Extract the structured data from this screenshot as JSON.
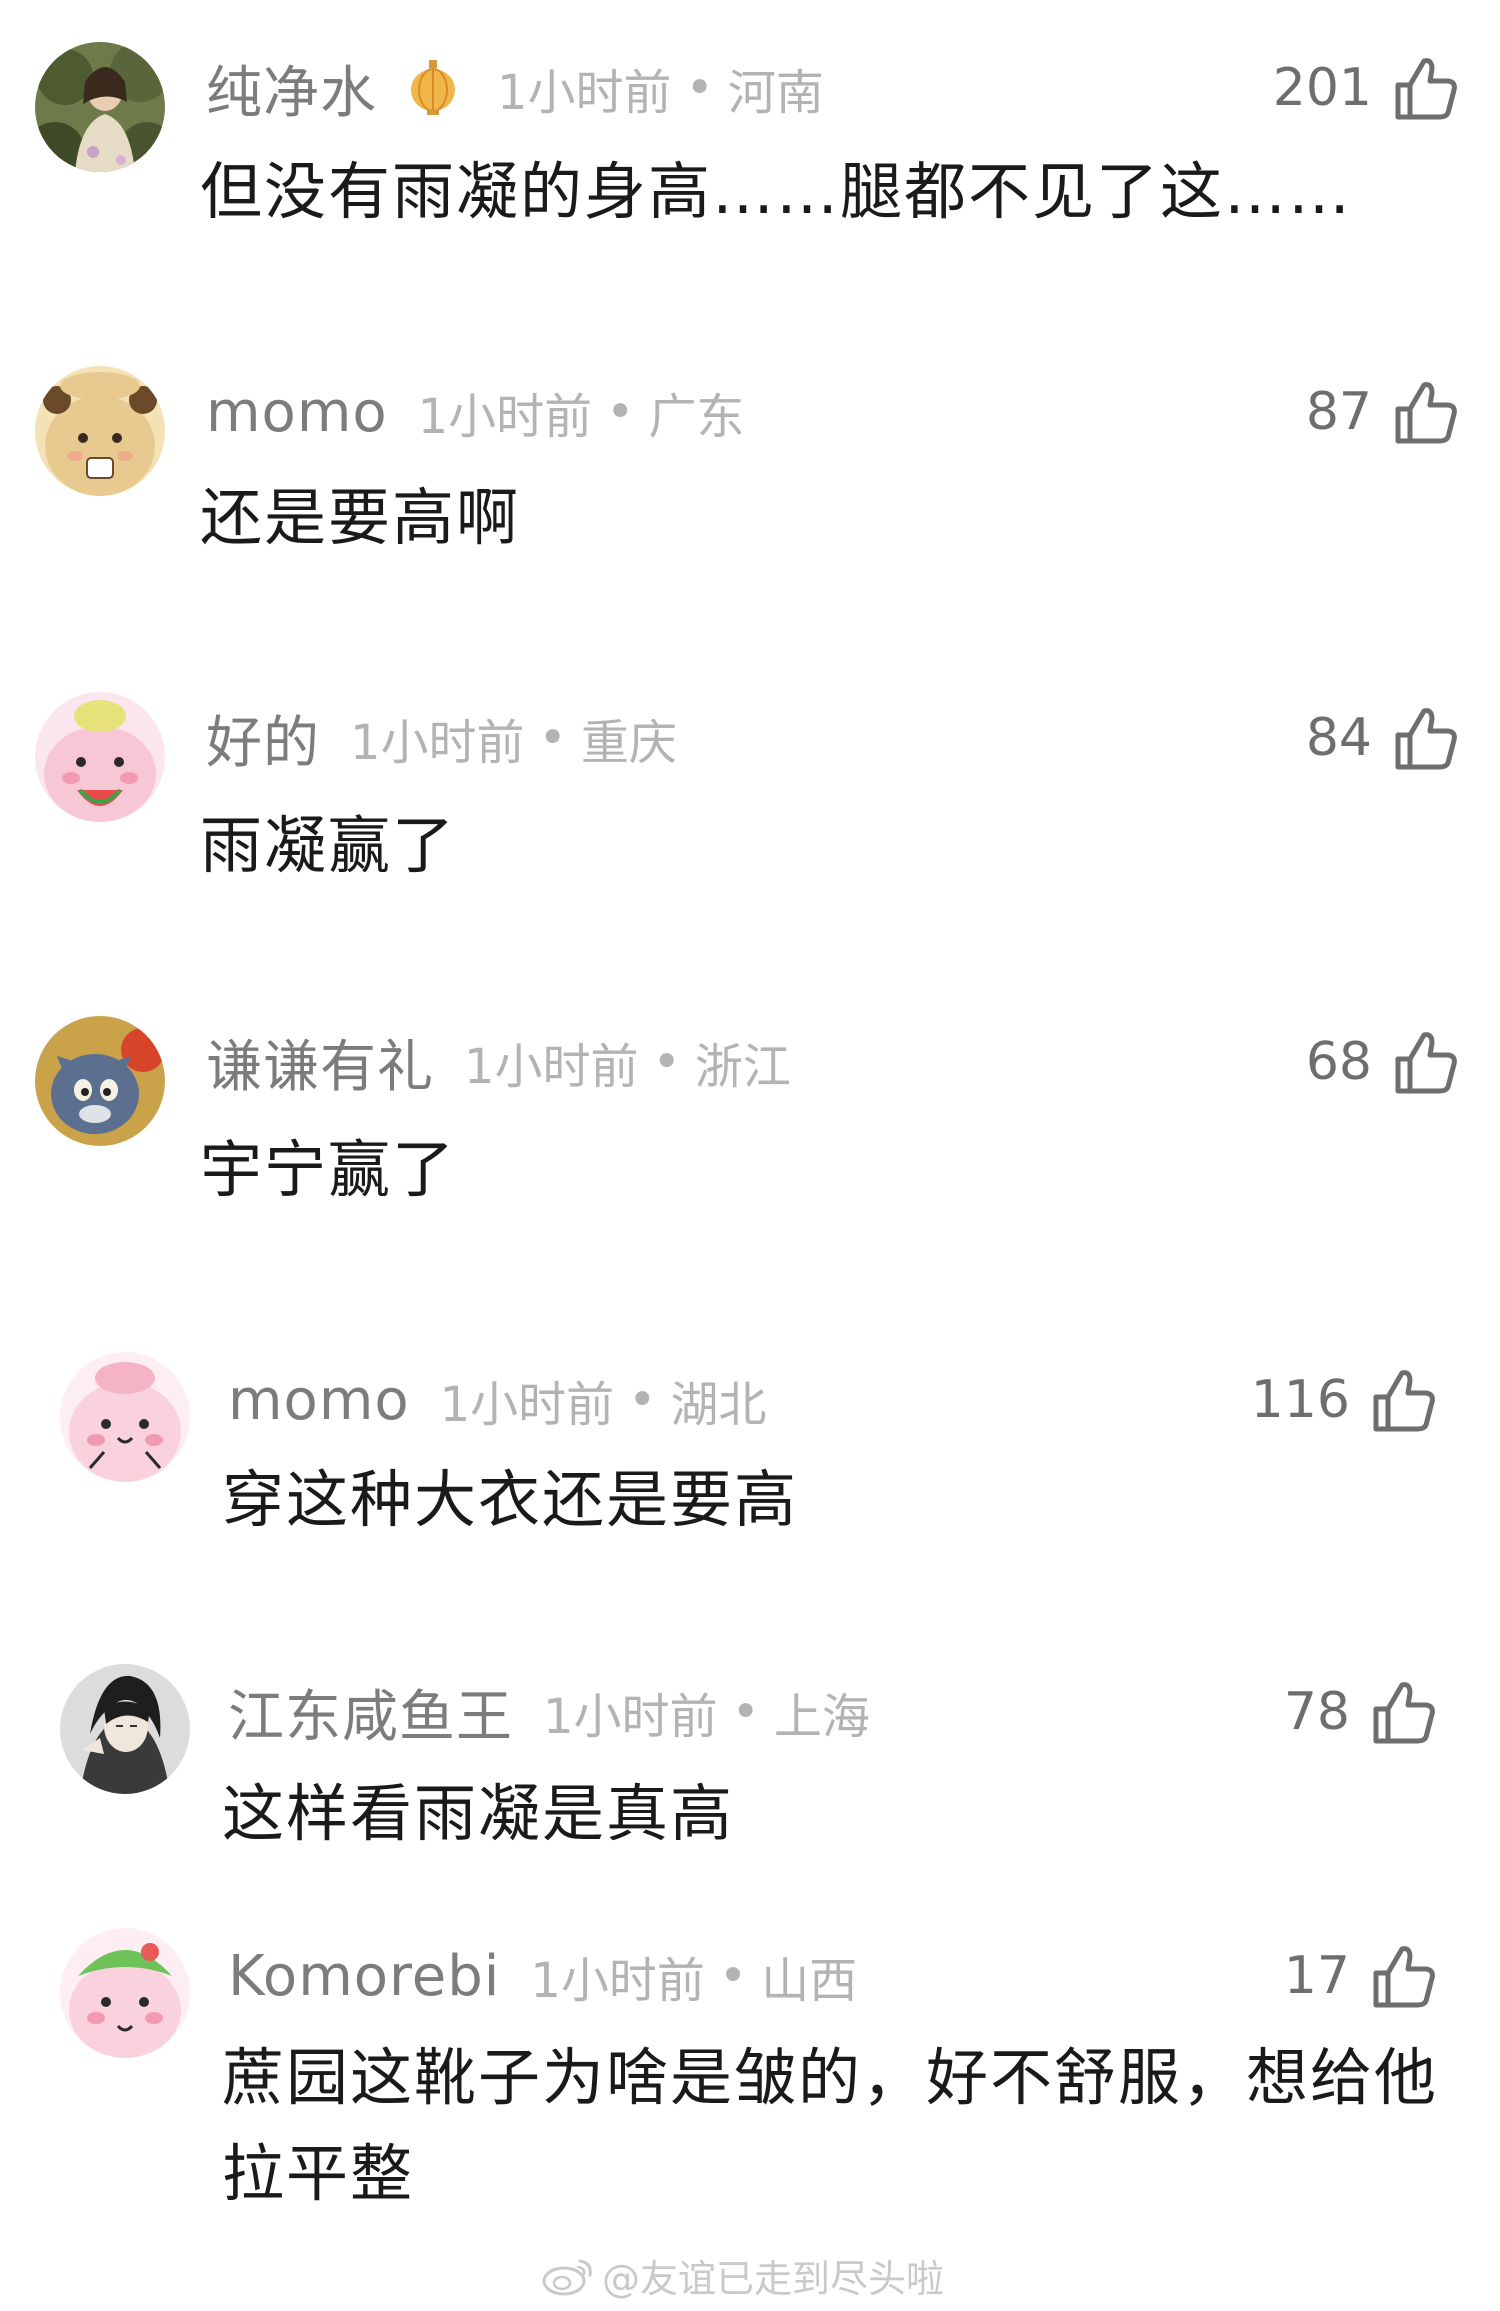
{
  "comments": [
    {
      "username": "纯净水",
      "time": "1小时前",
      "separator": "•",
      "region": "河南",
      "likes": "201",
      "text": "但没有雨凝的身高……腿都不见了这……",
      "avatar_icon": "avatar-girl-garden",
      "badge_icon": "lantern-icon"
    },
    {
      "username": "momo",
      "time": "1小时前",
      "separator": "•",
      "region": "广东",
      "likes": "87",
      "text": "还是要高啊",
      "avatar_icon": "avatar-cartoon-bear"
    },
    {
      "username": "好的",
      "time": "1小时前",
      "separator": "•",
      "region": "重庆",
      "likes": "84",
      "text": "雨凝赢了",
      "avatar_icon": "avatar-pink-watermelon"
    },
    {
      "username": "谦谦有礼",
      "time": "1小时前",
      "separator": "•",
      "region": "浙江",
      "likes": "68",
      "text": "宇宁赢了",
      "avatar_icon": "avatar-cartoon-cat"
    },
    {
      "username": "momo",
      "time": "1小时前",
      "separator": "•",
      "region": "湖北",
      "likes": "116",
      "text": "穿这种大衣还是要高",
      "avatar_icon": "avatar-pink-blob"
    },
    {
      "username": "江东咸鱼王",
      "time": "1小时前",
      "separator": "•",
      "region": "上海",
      "likes": "78",
      "text": "这样看雨凝是真高",
      "avatar_icon": "avatar-anime-man"
    },
    {
      "username": "Komorebi",
      "time": "1小时前",
      "separator": "•",
      "region": "山西",
      "likes": "17",
      "text": "蔗园这靴子为啥是皱的，好不舒服，想给他拉平整",
      "avatar_icon": "avatar-pink-green-hat"
    }
  ],
  "watermark": {
    "text": "@友谊已走到尽头啦",
    "icon": "weibo-icon"
  },
  "colors": {
    "username": "#7c7c7c",
    "meta": "#b3b3b3",
    "text": "#1a1a1a",
    "likes": "#6e6e6e"
  }
}
